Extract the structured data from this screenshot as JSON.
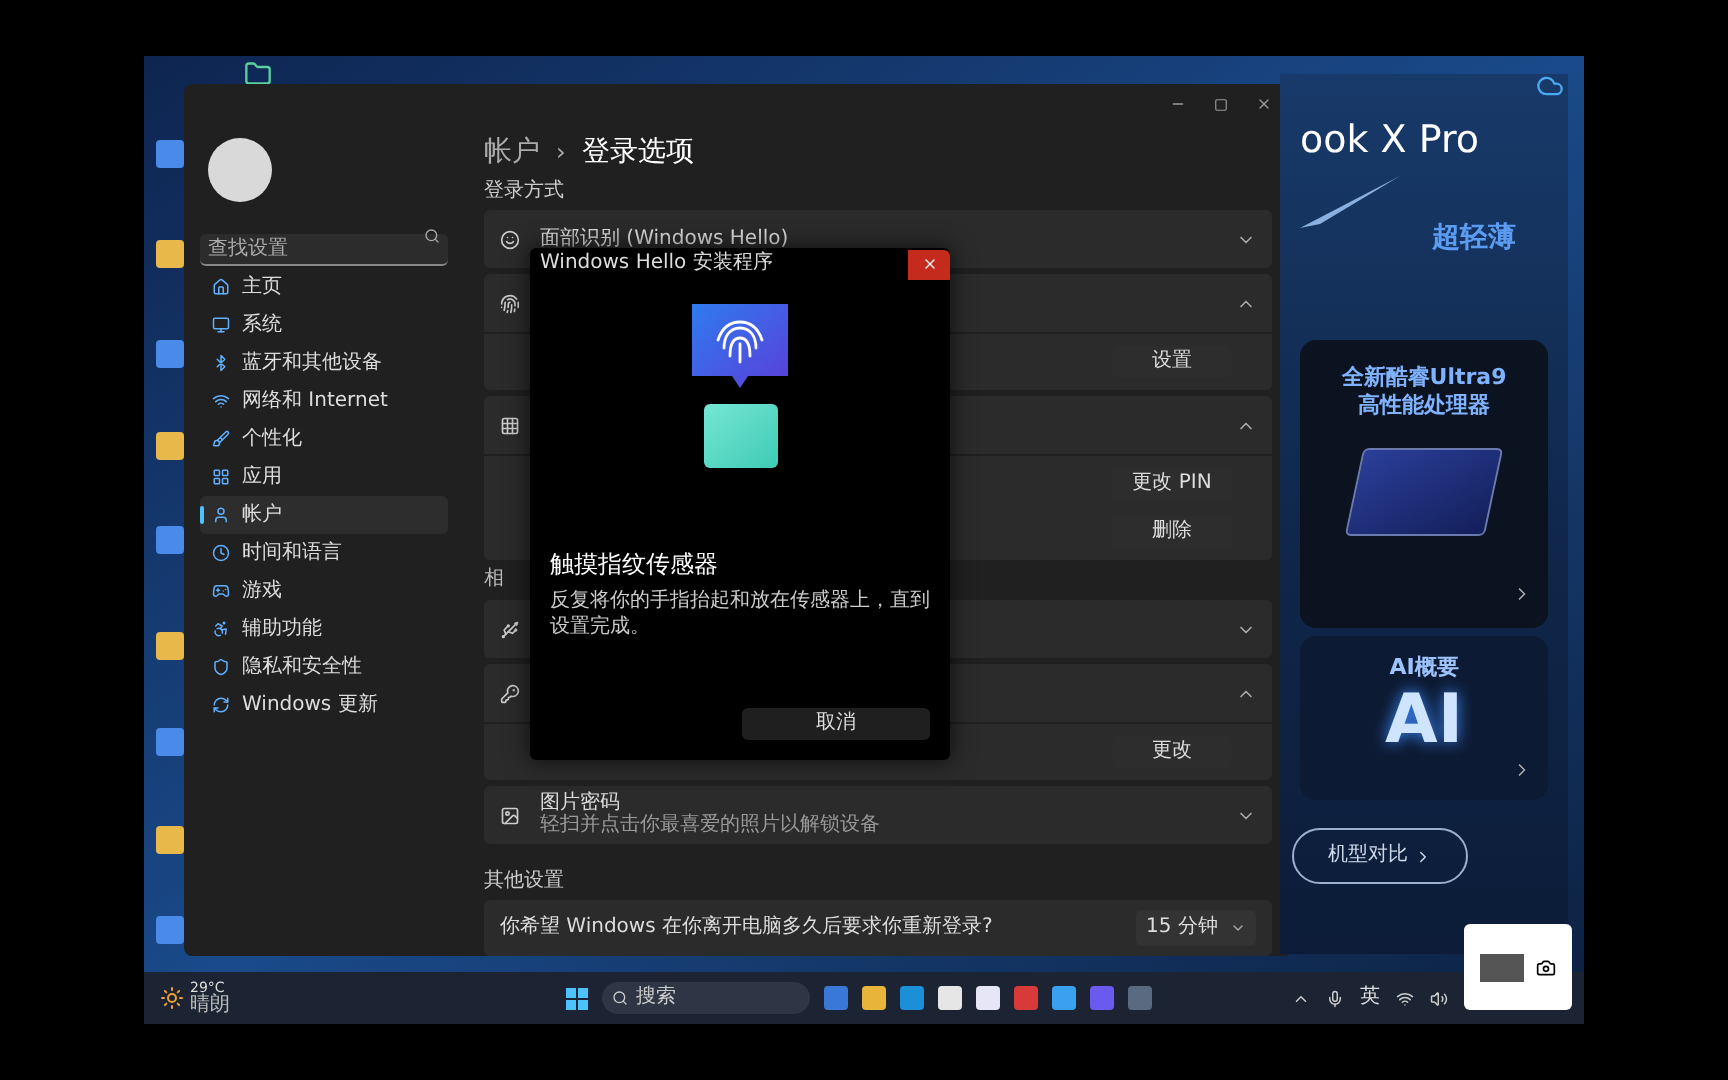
{
  "settings": {
    "search": {
      "placeholder": "查找设置"
    },
    "sidebar_items": [
      {
        "label": "主页",
        "kind": "home",
        "selected": false
      },
      {
        "label": "系统",
        "kind": "system",
        "selected": false
      },
      {
        "label": "蓝牙和其他设备",
        "kind": "bluetooth",
        "selected": false
      },
      {
        "label": "网络和 Internet",
        "kind": "network",
        "selected": false
      },
      {
        "label": "个性化",
        "kind": "brush",
        "selected": false
      },
      {
        "label": "应用",
        "kind": "apps",
        "selected": false
      },
      {
        "label": "帐户",
        "kind": "account",
        "selected": true
      },
      {
        "label": "时间和语言",
        "kind": "time",
        "selected": false
      },
      {
        "label": "游戏",
        "kind": "game",
        "selected": false
      },
      {
        "label": "辅助功能",
        "kind": "access",
        "selected": false
      },
      {
        "label": "隐私和安全性",
        "kind": "shield",
        "selected": false
      },
      {
        "label": "Windows 更新",
        "kind": "update",
        "selected": false
      }
    ],
    "breadcrumb": [
      "帐户",
      "登录选项"
    ],
    "breadcrumb_separator": "›",
    "section_title": "登录方式",
    "sign_in_rows": [
      {
        "kind": "face",
        "title": "面部识别 (Windows Hello)",
        "expanded": false
      },
      {
        "kind": "fingerprint",
        "expanded": true,
        "buttons": [
          "设置"
        ]
      },
      {
        "kind": "pin",
        "expanded": true,
        "buttons": [
          "更改 PIN",
          "删除"
        ]
      },
      {
        "kind": "label",
        "title": "相"
      },
      {
        "kind": "key",
        "expanded": false
      },
      {
        "kind": "password",
        "expanded": true,
        "buttons": [
          "更改"
        ]
      },
      {
        "kind": "picture",
        "title": "图片密码",
        "subtitle": "轻扫并点击你最喜爱的照片以解锁设备",
        "expanded": false
      }
    ],
    "other_title": "其他设置",
    "other_row": {
      "label": "你希望 Windows 在你离开电脑多久后要求你重新登录?",
      "value": "15 分钟"
    }
  },
  "dialog": {
    "title": "Windows Hello 安装程序",
    "heading": "触摸指纹传感器",
    "body": "反复将你的手指抬起和放在传感器上，直到设置完成。",
    "button": "取消"
  },
  "ad": {
    "title": "ook X Pro",
    "tagline": "超轻薄",
    "card_1": [
      "全新酷睿Ultra9",
      "高性能处理器"
    ],
    "card_2_title": "AI概要",
    "card_2_graphic": "AI",
    "button": "机型对比"
  },
  "taskbar": {
    "temperature": "29°C",
    "weather": "晴朗",
    "search": "搜索",
    "language": "英"
  }
}
